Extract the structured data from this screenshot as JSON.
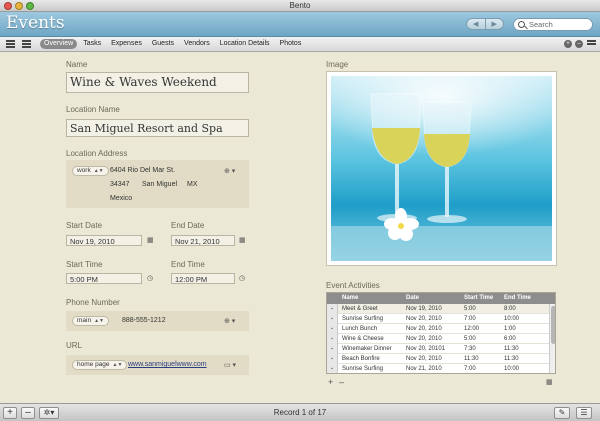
{
  "window": {
    "title": "Bento"
  },
  "header": {
    "title": "Events",
    "nav_back": "◀",
    "nav_forward": "▶",
    "search_placeholder": "Search"
  },
  "tabs": [
    {
      "label": "Overview",
      "active": true
    },
    {
      "label": "Tasks"
    },
    {
      "label": "Expenses"
    },
    {
      "label": "Guests"
    },
    {
      "label": "Vendors"
    },
    {
      "label": "Location Details"
    },
    {
      "label": "Photos"
    }
  ],
  "form": {
    "name_label": "Name",
    "name_value": "Wine & Waves Weekend",
    "location_name_label": "Location Name",
    "location_name_value": "San Miguel Resort and Spa",
    "location_address_label": "Location Address",
    "address": {
      "type": "work",
      "street": "6404 Rio Del Mar St.",
      "zip": "34347",
      "city": "San Miguel",
      "state": "MX",
      "country": "Mexico"
    },
    "start_date_label": "Start Date",
    "start_date_value": "Nov 19, 2010",
    "end_date_label": "End Date",
    "end_date_value": "Nov 21, 2010",
    "start_time_label": "Start Time",
    "start_time_value": "5:00 PM",
    "end_time_label": "End Time",
    "end_time_value": "12:00 PM",
    "phone_label": "Phone Number",
    "phone_type": "main",
    "phone_value": "888-555-1212",
    "url_label": "URL",
    "url_type": "home page",
    "url_value": "www.sanmiguelwww.com"
  },
  "image_label": "Image",
  "activities": {
    "label": "Event Activities",
    "columns": [
      "Name",
      "Date",
      "Start Time",
      "End Time"
    ],
    "rows": [
      [
        "Meet & Greet",
        "Nov 19, 2010",
        "5:00",
        "8:00"
      ],
      [
        "Sunrise Surfing",
        "Nov 20, 2010",
        "7:00",
        "10:00"
      ],
      [
        "Lunch Bunch",
        "Nov 20, 2010",
        "12:00",
        "1:00"
      ],
      [
        "Wine & Cheese",
        "Nov 20, 2010",
        "5:00",
        "6:00"
      ],
      [
        "Winemaker Dinner",
        "Nov 20, 20101",
        "7:30",
        "11:30"
      ],
      [
        "Beach Bonfire",
        "Nov 20, 2010",
        "11:30",
        "11:30"
      ],
      [
        "Sunrise Surfing",
        "Nov 21, 2010",
        "7:00",
        "10:00"
      ]
    ]
  },
  "footer": {
    "record_text": "Record 1 of 17"
  },
  "colors": {
    "header": "#7fb3d0",
    "background": "#ece8d6",
    "address_block": "#e2dcc6"
  }
}
